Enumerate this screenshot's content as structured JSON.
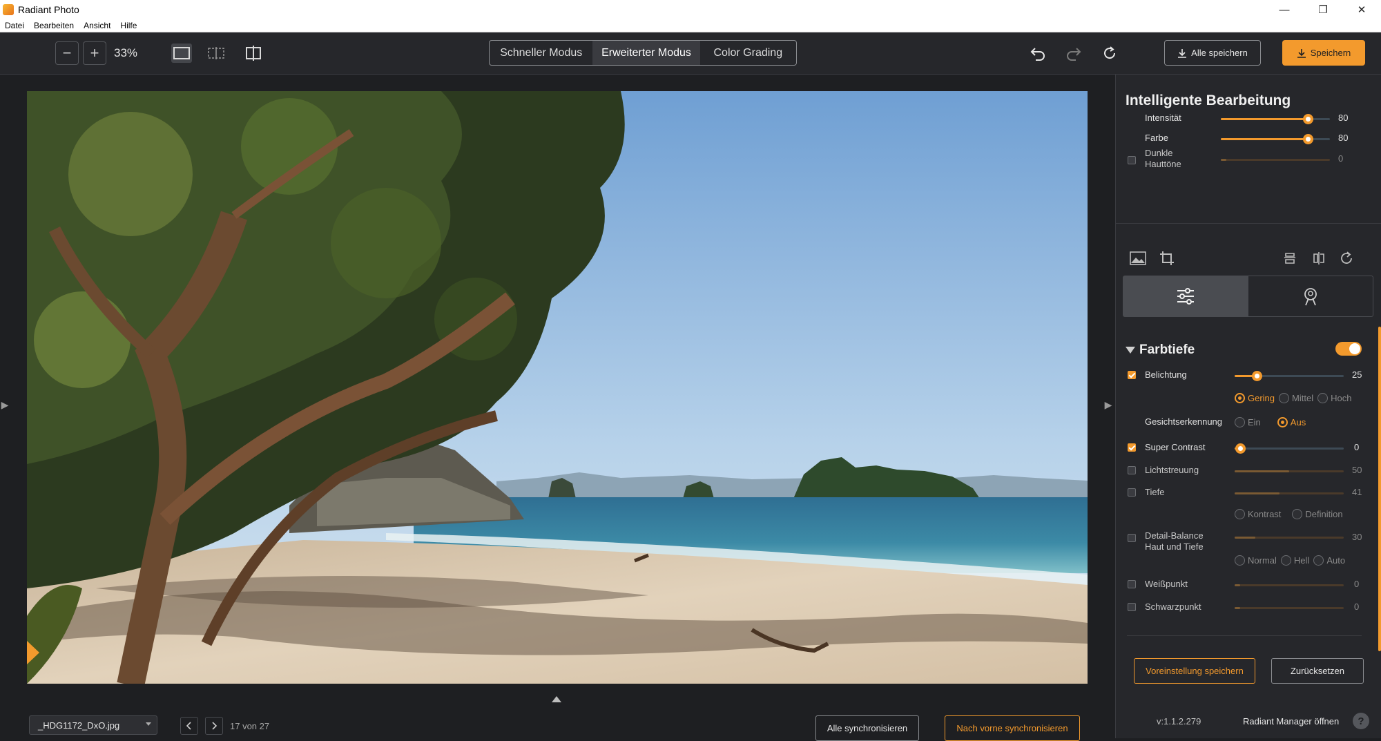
{
  "window": {
    "title": "Radiant Photo",
    "controls": {
      "minimize": "—",
      "maximize": "❐",
      "close": "✕"
    }
  },
  "menu": [
    "Datei",
    "Bearbeiten",
    "Ansicht",
    "Hilfe"
  ],
  "toolbar": {
    "zoom_out": "−",
    "zoom_in": "+",
    "zoom_level": "33%",
    "modes": [
      {
        "label": "Schneller Modus",
        "active": false
      },
      {
        "label": "Erweiterter Modus",
        "active": true
      },
      {
        "label": "Color Grading",
        "active": false
      }
    ],
    "save_all_label": "Alle speichern",
    "save_label": "Speichern"
  },
  "bottom": {
    "filename": "_HDG1172_DxO.jpg",
    "counter": "17 von 27",
    "sync_all_label": "Alle synchronisieren",
    "sync_front_label": "Nach vorne synchronisieren"
  },
  "panel": {
    "title": "Intelligente Bearbeitung",
    "smart_rows": [
      {
        "label": "Intensität",
        "value": "80",
        "fraction": 0.8,
        "checkbox": false,
        "active": true
      },
      {
        "label": "Farbe",
        "value": "80",
        "fraction": 0.8,
        "checkbox": false,
        "active": true
      },
      {
        "label": "Dunkle\nHauttöne",
        "value": "0",
        "fraction": 0.0,
        "checkbox": true,
        "checked": false,
        "active": false
      }
    ],
    "section_title": "Farbtiefe",
    "section_enabled": true,
    "rows": [
      {
        "label": "Belichtung",
        "value": "25",
        "fraction": 0.2,
        "checked": true,
        "active": true
      },
      {
        "label": "Super Contrast",
        "value": "0",
        "fraction": 0.05,
        "checked": true,
        "active": true
      },
      {
        "label": "Lichtstreuung",
        "value": "50",
        "fraction": 0.5,
        "checked": false,
        "active": false
      },
      {
        "label": "Tiefe",
        "value": "41",
        "fraction": 0.41,
        "checked": false,
        "active": false
      },
      {
        "label": "Detail-Balance\nHaut und Tiefe",
        "value": "30",
        "fraction": 0.19,
        "checked": false,
        "active": false
      },
      {
        "label": "Weißpunkt",
        "value": "0",
        "fraction": 0.0,
        "checked": false,
        "active": false
      },
      {
        "label": "Schwarzpunkt",
        "value": "0",
        "fraction": 0.0,
        "checked": false,
        "active": false
      }
    ],
    "exposure_radios": [
      {
        "label": "Gering",
        "selected": true
      },
      {
        "label": "Mittel",
        "selected": false
      },
      {
        "label": "Hoch",
        "selected": false
      }
    ],
    "face_detection_label": "Gesichtserkennung",
    "face_radios": [
      {
        "label": "Ein",
        "selected": false
      },
      {
        "label": "Aus",
        "selected": true
      }
    ],
    "depth_radios": [
      {
        "label": "Kontrast",
        "selected": false
      },
      {
        "label": "Definition",
        "selected": false
      }
    ],
    "balance_radios": [
      {
        "label": "Normal",
        "selected": false
      },
      {
        "label": "Hell",
        "selected": false
      },
      {
        "label": "Auto",
        "selected": false
      }
    ],
    "preset_label": "Voreinstellung speichern",
    "reset_label": "Zurücksetzen",
    "version": "v:1.1.2.279",
    "manager_label": "Radiant Manager öffnen",
    "help": "?"
  },
  "colors": {
    "accent": "#f39a2d",
    "background": "#1e1f22",
    "panel": "#26272b"
  }
}
